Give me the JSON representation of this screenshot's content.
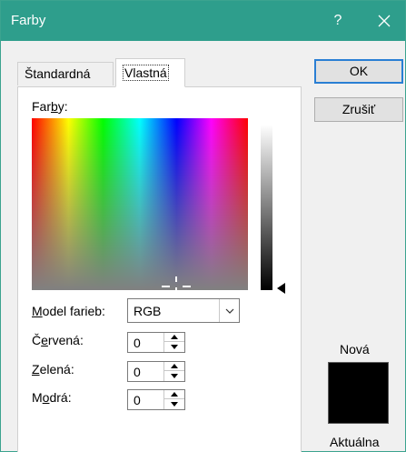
{
  "window": {
    "title": "Farby",
    "help_label": "?",
    "close_icon": "close-icon",
    "titlebar_color": "#2e9e8c"
  },
  "tabs": [
    {
      "label": "Štandardná",
      "active": false
    },
    {
      "label": "Vlastná",
      "active": true
    }
  ],
  "custom": {
    "colors_label_pre": "Far",
    "colors_label_u": "b",
    "colors_label_post": "y:",
    "model": {
      "label_u": "M",
      "label_rest": "odel farieb:",
      "value": "RGB"
    },
    "red": {
      "label_pre": "Č",
      "label_u": "e",
      "label_post": "rvená:",
      "value": "0"
    },
    "green": {
      "label_pre": "",
      "label_u": "Z",
      "label_post": "elená:",
      "value": "0"
    },
    "blue": {
      "label_pre": "M",
      "label_u": "o",
      "label_post": "drá:",
      "value": "0"
    }
  },
  "buttons": {
    "ok": "OK",
    "cancel": "Zrušiť"
  },
  "preview": {
    "new_label": "Nová",
    "current_label": "Aktuálna",
    "color": "#000000"
  }
}
